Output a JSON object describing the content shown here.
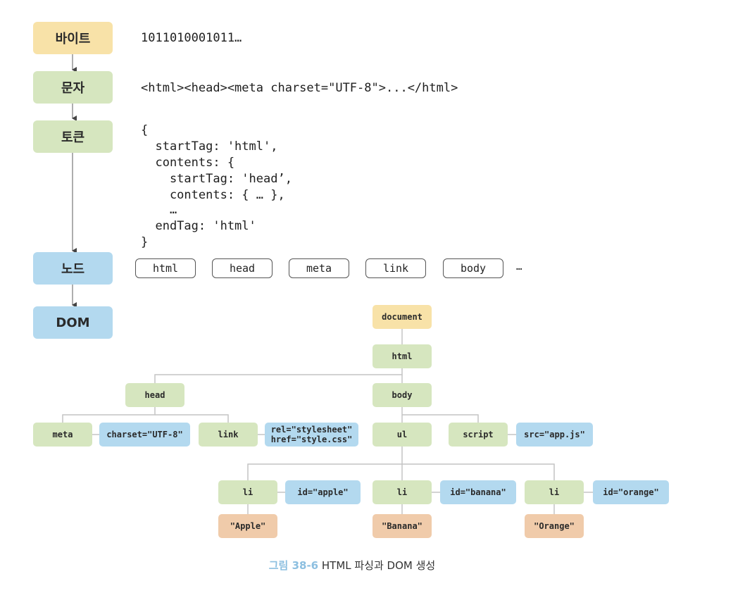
{
  "stages": [
    {
      "label": "바이트",
      "color": "#f8e2a8"
    },
    {
      "label": "문자",
      "color": "#d6e6bf"
    },
    {
      "label": "토큰",
      "color": "#d6e6bf"
    },
    {
      "label": "노드",
      "color": "#b3d9ef"
    },
    {
      "label": "DOM",
      "color": "#b3d9ef"
    }
  ],
  "bytes_text": "1011010001011…",
  "chars_text": "<html><head><meta charset=\"UTF-8\">...</html>",
  "token_lines": [
    "{",
    "  startTag: 'html',",
    "  contents: {",
    "    startTag: 'head’,",
    "    contents: { … },",
    "    …",
    "  endTag: 'html'",
    "}"
  ],
  "nodes": [
    "html",
    "head",
    "meta",
    "link",
    "body"
  ],
  "nodes_more": "…",
  "dom_tree": {
    "document": "document",
    "html": "html",
    "head": "head",
    "body": "body",
    "meta": "meta",
    "meta_attr": "charset=\"UTF-8\"",
    "link": "link",
    "link_attr_1": "rel=\"stylesheet\"",
    "link_attr_2": "href=\"style.css\"",
    "ul": "ul",
    "script": "script",
    "script_attr": "src=\"app.js\"",
    "li_items": [
      {
        "tag": "li",
        "attr": "id=\"apple\"",
        "text": "\"Apple\""
      },
      {
        "tag": "li",
        "attr": "id=\"banana\"",
        "text": "\"Banana\""
      },
      {
        "tag": "li",
        "attr": "id=\"orange\"",
        "text": "\"Orange\""
      }
    ]
  },
  "caption": {
    "figure": "그림 38-6",
    "title": " HTML 파싱과 DOM 생성"
  },
  "colors": {
    "document": "#f8e2a8",
    "element": "#d6e6bf",
    "attribute": "#b3d9ef",
    "text": "#f0cbaa",
    "caption_accent": "#8cbfe0"
  }
}
